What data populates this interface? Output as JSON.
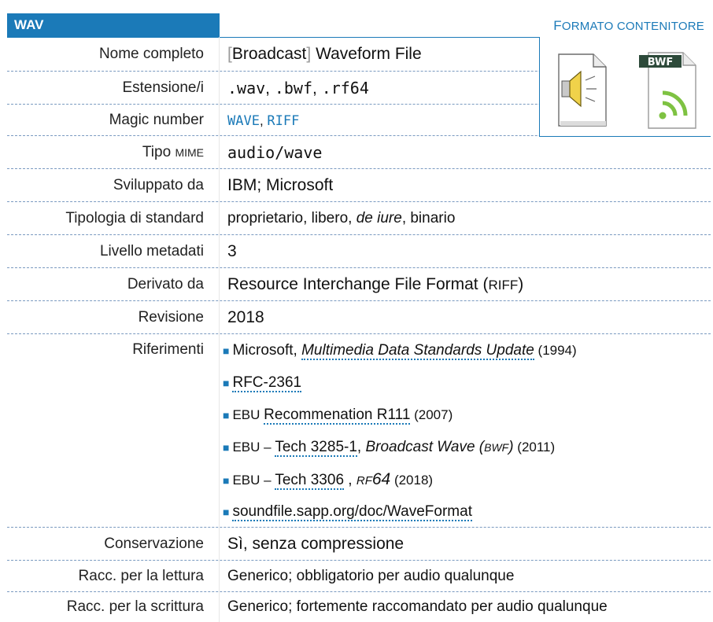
{
  "header": {
    "format": "WAV",
    "category_first": "F",
    "category_rest": "ORMATO CONTENITORE"
  },
  "rows": {
    "nome": {
      "label": "Nome completo",
      "bracket_open": "[",
      "word1": "Broadcast",
      "bracket_close": "]",
      "rest": " Waveform File"
    },
    "estensione": {
      "label": "Estensione/i",
      "ext1": ".wav",
      "ext2": ".bwf",
      "ext3": ".rf64"
    },
    "magic": {
      "label": "Magic number",
      "m1": "WAVE",
      "m2": "RIFF"
    },
    "mime": {
      "label_main": "Tipo ",
      "label_small": "MIME",
      "value": "audio/wave"
    },
    "sviluppato": {
      "label": "Sviluppato da",
      "value": "IBM;  Microsoft"
    },
    "tipologia": {
      "label": "Tipologia di standard",
      "v1": "proprietario, libero, ",
      "v2": "de iure",
      "v3": ", binario"
    },
    "livello": {
      "label": "Livello metadati",
      "value": "3"
    },
    "derivato": {
      "label": "Derivato da",
      "v1": "Resource Interchange File Format (",
      "v2": "RIFF",
      "v3": ")"
    },
    "revisione": {
      "label": "Revisione",
      "value": "2018"
    },
    "riferimenti": {
      "label": "Riferimenti",
      "r1": {
        "pre": "Microsoft, ",
        "title": "Multimedia Data Standards Update",
        "year": " (1994)"
      },
      "r2": {
        "link": "RFC-2361"
      },
      "r3": {
        "pre": "EBU ",
        "link": "Recommenation R111",
        "year": "  (2007)"
      },
      "r4": {
        "pre": "EBU – ",
        "link": "Tech 3285-1",
        "mid": ", ",
        "title": "Broadcast Wave (",
        "title_sc": "BWF",
        "title_end": ")",
        "year": " (2011)"
      },
      "r5": {
        "pre": "EBU – ",
        "link": "Tech 3306",
        "mid": " , ",
        "t1": "RF",
        "t2": "64",
        "year": "  (2018)"
      },
      "r6": {
        "link": "soundfile.sapp.org/doc/WaveFormat"
      }
    },
    "conservazione": {
      "label": "Conservazione",
      "value": "Sì, senza compressione"
    },
    "lettura": {
      "label": "Racc. per la lettura",
      "value": "Generico; obbligatorio per audio qualunque"
    },
    "scrittura": {
      "label": "Racc. per la scrittura",
      "value": "Generico; fortemente raccomandato per audio qualunque"
    }
  },
  "icons": {
    "bwf_badge": "BWF"
  },
  "colors": {
    "accent": "#1b7ab8",
    "wifi_green": "#7ec242"
  }
}
